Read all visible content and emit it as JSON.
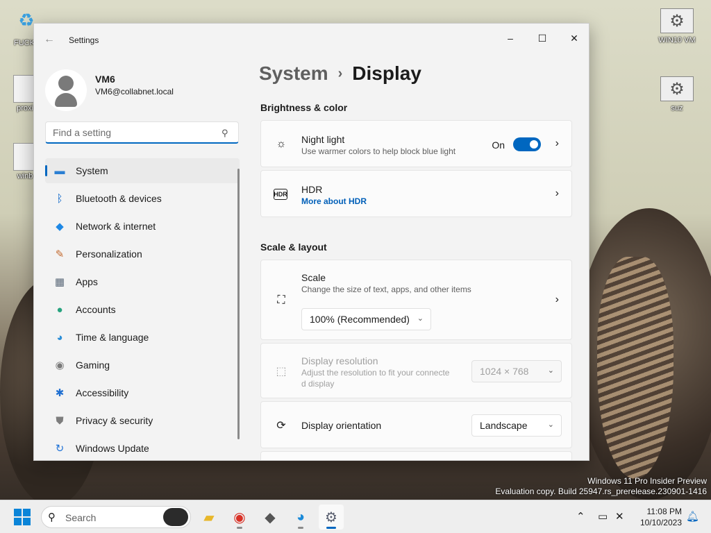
{
  "desktop": {
    "icons_left": [
      "FUCK I",
      "proxi",
      "winb"
    ],
    "icons_right": [
      "WIN10 VM",
      "suz"
    ]
  },
  "window": {
    "title": "Settings",
    "controls": {
      "minimize": "–",
      "maximize": "☐",
      "close": "✕"
    }
  },
  "profile": {
    "name": "VM6",
    "email": "VM6@collabnet.local"
  },
  "search": {
    "placeholder": "Find a setting"
  },
  "nav": [
    {
      "label": "System",
      "icon": "monitor-icon",
      "glyph": "▬",
      "color": "#2b7fd3"
    },
    {
      "label": "Bluetooth & devices",
      "icon": "bluetooth-icon",
      "glyph": "ᛒ",
      "color": "#0a64c8"
    },
    {
      "label": "Network & internet",
      "icon": "wifi-icon",
      "glyph": "◆",
      "color": "#1e88e5"
    },
    {
      "label": "Personalization",
      "icon": "brush-icon",
      "glyph": "✎",
      "color": "#c46a2f"
    },
    {
      "label": "Apps",
      "icon": "apps-icon",
      "glyph": "▦",
      "color": "#5a6878"
    },
    {
      "label": "Accounts",
      "icon": "person-icon",
      "glyph": "●",
      "color": "#27a37f"
    },
    {
      "label": "Time & language",
      "icon": "globe-clock-icon",
      "glyph": "◕",
      "color": "#2d8fd8"
    },
    {
      "label": "Gaming",
      "icon": "controller-icon",
      "glyph": "◉",
      "color": "#7a7a7a"
    },
    {
      "label": "Accessibility",
      "icon": "accessibility-icon",
      "glyph": "✱",
      "color": "#1f6fd1"
    },
    {
      "label": "Privacy & security",
      "icon": "shield-icon",
      "glyph": "⛊",
      "color": "#7d7d7d"
    },
    {
      "label": "Windows Update",
      "icon": "sync-icon",
      "glyph": "↻",
      "color": "#1f72d6"
    }
  ],
  "breadcrumb": {
    "parent": "System",
    "separator": "›",
    "current": "Display"
  },
  "sections": {
    "brightness": "Brightness & color",
    "scale_layout": "Scale & layout"
  },
  "night_light": {
    "title": "Night light",
    "subtitle": "Use warmer colors to help block blue light",
    "state": "On"
  },
  "hdr": {
    "title": "HDR",
    "link": "More about HDR"
  },
  "scale": {
    "title": "Scale",
    "subtitle": "Change the size of text, apps, and other items",
    "value": "100% (Recommended)"
  },
  "resolution": {
    "title": "Display resolution",
    "subtitle_line1": "Adjust the resolution to fit your connecte",
    "subtitle_line2": "d display",
    "value": "1024 × 768"
  },
  "orientation": {
    "title": "Display orientation",
    "value": "Landscape"
  },
  "watermark": {
    "line1": "Windows 11 Pro Insider Preview",
    "line2": "Evaluation copy. Build 25947.rs_prerelease.230901-1416"
  },
  "taskbar": {
    "search_label": "Search",
    "time": "11:08 PM",
    "date": "10/10/2023"
  }
}
